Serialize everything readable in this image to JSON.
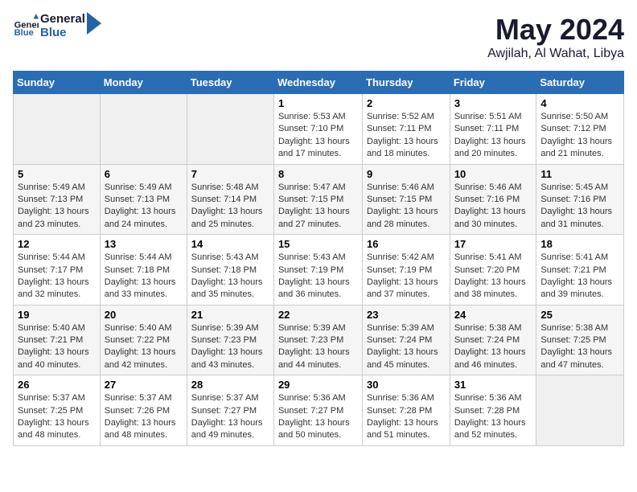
{
  "logo": {
    "text_general": "General",
    "text_blue": "Blue"
  },
  "header": {
    "month": "May 2024",
    "location": "Awjilah, Al Wahat, Libya"
  },
  "weekdays": [
    "Sunday",
    "Monday",
    "Tuesday",
    "Wednesday",
    "Thursday",
    "Friday",
    "Saturday"
  ],
  "weeks": [
    [
      {
        "day": "",
        "sunrise": "",
        "sunset": "",
        "daylight": ""
      },
      {
        "day": "",
        "sunrise": "",
        "sunset": "",
        "daylight": ""
      },
      {
        "day": "",
        "sunrise": "",
        "sunset": "",
        "daylight": ""
      },
      {
        "day": "1",
        "sunrise": "Sunrise: 5:53 AM",
        "sunset": "Sunset: 7:10 PM",
        "daylight": "Daylight: 13 hours and 17 minutes."
      },
      {
        "day": "2",
        "sunrise": "Sunrise: 5:52 AM",
        "sunset": "Sunset: 7:11 PM",
        "daylight": "Daylight: 13 hours and 18 minutes."
      },
      {
        "day": "3",
        "sunrise": "Sunrise: 5:51 AM",
        "sunset": "Sunset: 7:11 PM",
        "daylight": "Daylight: 13 hours and 20 minutes."
      },
      {
        "day": "4",
        "sunrise": "Sunrise: 5:50 AM",
        "sunset": "Sunset: 7:12 PM",
        "daylight": "Daylight: 13 hours and 21 minutes."
      }
    ],
    [
      {
        "day": "5",
        "sunrise": "Sunrise: 5:49 AM",
        "sunset": "Sunset: 7:13 PM",
        "daylight": "Daylight: 13 hours and 23 minutes."
      },
      {
        "day": "6",
        "sunrise": "Sunrise: 5:49 AM",
        "sunset": "Sunset: 7:13 PM",
        "daylight": "Daylight: 13 hours and 24 minutes."
      },
      {
        "day": "7",
        "sunrise": "Sunrise: 5:48 AM",
        "sunset": "Sunset: 7:14 PM",
        "daylight": "Daylight: 13 hours and 25 minutes."
      },
      {
        "day": "8",
        "sunrise": "Sunrise: 5:47 AM",
        "sunset": "Sunset: 7:15 PM",
        "daylight": "Daylight: 13 hours and 27 minutes."
      },
      {
        "day": "9",
        "sunrise": "Sunrise: 5:46 AM",
        "sunset": "Sunset: 7:15 PM",
        "daylight": "Daylight: 13 hours and 28 minutes."
      },
      {
        "day": "10",
        "sunrise": "Sunrise: 5:46 AM",
        "sunset": "Sunset: 7:16 PM",
        "daylight": "Daylight: 13 hours and 30 minutes."
      },
      {
        "day": "11",
        "sunrise": "Sunrise: 5:45 AM",
        "sunset": "Sunset: 7:16 PM",
        "daylight": "Daylight: 13 hours and 31 minutes."
      }
    ],
    [
      {
        "day": "12",
        "sunrise": "Sunrise: 5:44 AM",
        "sunset": "Sunset: 7:17 PM",
        "daylight": "Daylight: 13 hours and 32 minutes."
      },
      {
        "day": "13",
        "sunrise": "Sunrise: 5:44 AM",
        "sunset": "Sunset: 7:18 PM",
        "daylight": "Daylight: 13 hours and 33 minutes."
      },
      {
        "day": "14",
        "sunrise": "Sunrise: 5:43 AM",
        "sunset": "Sunset: 7:18 PM",
        "daylight": "Daylight: 13 hours and 35 minutes."
      },
      {
        "day": "15",
        "sunrise": "Sunrise: 5:43 AM",
        "sunset": "Sunset: 7:19 PM",
        "daylight": "Daylight: 13 hours and 36 minutes."
      },
      {
        "day": "16",
        "sunrise": "Sunrise: 5:42 AM",
        "sunset": "Sunset: 7:19 PM",
        "daylight": "Daylight: 13 hours and 37 minutes."
      },
      {
        "day": "17",
        "sunrise": "Sunrise: 5:41 AM",
        "sunset": "Sunset: 7:20 PM",
        "daylight": "Daylight: 13 hours and 38 minutes."
      },
      {
        "day": "18",
        "sunrise": "Sunrise: 5:41 AM",
        "sunset": "Sunset: 7:21 PM",
        "daylight": "Daylight: 13 hours and 39 minutes."
      }
    ],
    [
      {
        "day": "19",
        "sunrise": "Sunrise: 5:40 AM",
        "sunset": "Sunset: 7:21 PM",
        "daylight": "Daylight: 13 hours and 40 minutes."
      },
      {
        "day": "20",
        "sunrise": "Sunrise: 5:40 AM",
        "sunset": "Sunset: 7:22 PM",
        "daylight": "Daylight: 13 hours and 42 minutes."
      },
      {
        "day": "21",
        "sunrise": "Sunrise: 5:39 AM",
        "sunset": "Sunset: 7:23 PM",
        "daylight": "Daylight: 13 hours and 43 minutes."
      },
      {
        "day": "22",
        "sunrise": "Sunrise: 5:39 AM",
        "sunset": "Sunset: 7:23 PM",
        "daylight": "Daylight: 13 hours and 44 minutes."
      },
      {
        "day": "23",
        "sunrise": "Sunrise: 5:39 AM",
        "sunset": "Sunset: 7:24 PM",
        "daylight": "Daylight: 13 hours and 45 minutes."
      },
      {
        "day": "24",
        "sunrise": "Sunrise: 5:38 AM",
        "sunset": "Sunset: 7:24 PM",
        "daylight": "Daylight: 13 hours and 46 minutes."
      },
      {
        "day": "25",
        "sunrise": "Sunrise: 5:38 AM",
        "sunset": "Sunset: 7:25 PM",
        "daylight": "Daylight: 13 hours and 47 minutes."
      }
    ],
    [
      {
        "day": "26",
        "sunrise": "Sunrise: 5:37 AM",
        "sunset": "Sunset: 7:25 PM",
        "daylight": "Daylight: 13 hours and 48 minutes."
      },
      {
        "day": "27",
        "sunrise": "Sunrise: 5:37 AM",
        "sunset": "Sunset: 7:26 PM",
        "daylight": "Daylight: 13 hours and 48 minutes."
      },
      {
        "day": "28",
        "sunrise": "Sunrise: 5:37 AM",
        "sunset": "Sunset: 7:27 PM",
        "daylight": "Daylight: 13 hours and 49 minutes."
      },
      {
        "day": "29",
        "sunrise": "Sunrise: 5:36 AM",
        "sunset": "Sunset: 7:27 PM",
        "daylight": "Daylight: 13 hours and 50 minutes."
      },
      {
        "day": "30",
        "sunrise": "Sunrise: 5:36 AM",
        "sunset": "Sunset: 7:28 PM",
        "daylight": "Daylight: 13 hours and 51 minutes."
      },
      {
        "day": "31",
        "sunrise": "Sunrise: 5:36 AM",
        "sunset": "Sunset: 7:28 PM",
        "daylight": "Daylight: 13 hours and 52 minutes."
      },
      {
        "day": "",
        "sunrise": "",
        "sunset": "",
        "daylight": ""
      }
    ]
  ]
}
